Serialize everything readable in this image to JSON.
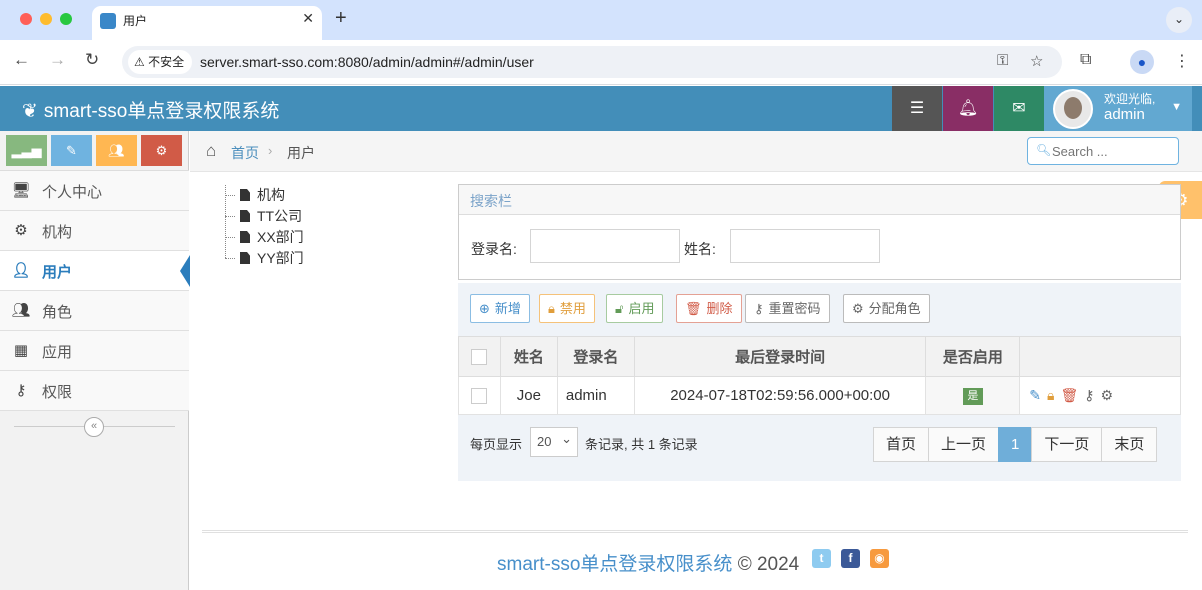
{
  "browser": {
    "tab_title": "用户",
    "close_glyph": "✕",
    "new_tab_glyph": "+",
    "security_label": "不安全",
    "url": "server.smart-sso.com:8080/admin/admin#/admin/user"
  },
  "header": {
    "brand": "smart-sso单点登录权限系统",
    "welcome": "欢迎光临,",
    "username": "admin"
  },
  "sidebar": {
    "items": [
      {
        "label": "个人中心",
        "icon": "desktop-icon"
      },
      {
        "label": "机构",
        "icon": "cogs-icon"
      },
      {
        "label": "用户",
        "icon": "user-icon"
      },
      {
        "label": "角色",
        "icon": "users-icon"
      },
      {
        "label": "应用",
        "icon": "grid-icon"
      },
      {
        "label": "权限",
        "icon": "key-icon"
      }
    ],
    "active": "用户"
  },
  "breadcrumb": {
    "home": "首页",
    "current": "用户"
  },
  "search": {
    "placeholder": "Search ..."
  },
  "tree": {
    "nodes": [
      "机构",
      "TT公司",
      "XX部门",
      "YY部门"
    ]
  },
  "search_panel": {
    "title": "搜索栏",
    "login_label": "登录名:",
    "name_label": "姓名:"
  },
  "toolbar": {
    "add": "新增",
    "disable": "禁用",
    "enable": "启用",
    "delete": "删除",
    "reset_password": "重置密码",
    "assign_role": "分配角色"
  },
  "table": {
    "headers": [
      "姓名",
      "登录名",
      "最后登录时间",
      "是否启用"
    ],
    "rows": [
      {
        "name": "Joe",
        "login": "admin",
        "last_login": "2024-07-18T02:59:56.000+00:00",
        "enabled": "是"
      }
    ]
  },
  "pager": {
    "per_page_label": "每页显示",
    "page_size": "20",
    "summary": "条记录, 共 1 条记录",
    "first": "首页",
    "prev": "上一页",
    "current": "1",
    "next": "下一页",
    "last": "末页"
  },
  "footer": {
    "brand": "smart-sso单点登录权限系统",
    "copyright": "© 2024"
  },
  "colors": {
    "header": "#438eb9",
    "accent": "#2b7dbc",
    "shortcut_success": "#87b87f",
    "shortcut_info": "#6fb3e0",
    "shortcut_warning": "#ffb752",
    "shortcut_danger": "#d15b47"
  }
}
